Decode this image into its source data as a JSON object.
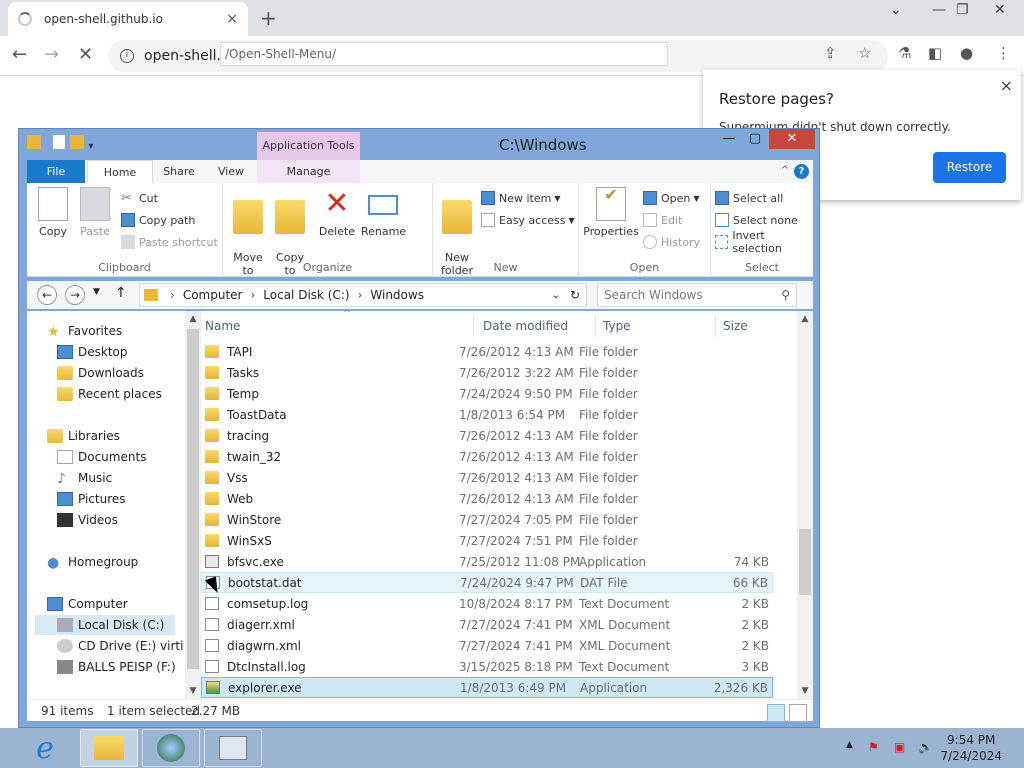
{
  "browser": {
    "tab_title": "open-shell.github.io",
    "tab_close": "×",
    "new_tab": "+",
    "url_host": "open-shell.github.io",
    "url_path": "/Open-Shell-Menu/",
    "restore_popup": {
      "title": "Restore pages?",
      "message": "Supermium didn't shut down correctly.",
      "button": "Restore",
      "close": "×"
    }
  },
  "explorer": {
    "title": "C:\\Windows",
    "context_tab_group": "Application Tools",
    "tabs": [
      "File",
      "Home",
      "Share",
      "View",
      "Manage"
    ],
    "help": "?",
    "ribbon": {
      "clipboard": {
        "label": "Clipboard",
        "copy": "Copy",
        "paste": "Paste",
        "cut": "Cut",
        "copy_path": "Copy path",
        "paste_shortcut": "Paste shortcut"
      },
      "organize": {
        "label": "Organize",
        "move_to": "Move\nto",
        "copy_to": "Copy\nto",
        "delete": "Delete",
        "rename": "Rename"
      },
      "new": {
        "label": "New",
        "new_folder": "New\nfolder",
        "new_item": "New item",
        "easy_access": "Easy access"
      },
      "open": {
        "label": "Open",
        "properties": "Properties",
        "open": "Open",
        "edit": "Edit",
        "history": "History"
      },
      "select": {
        "label": "Select",
        "select_all": "Select all",
        "select_none": "Select none",
        "invert_selection": "Invert selection"
      }
    },
    "address": {
      "crumbs": [
        "Computer",
        "Local Disk (C:)",
        "Windows"
      ],
      "search_placeholder": "Search Windows"
    },
    "nav": {
      "favorites": "Favorites",
      "desktop": "Desktop",
      "downloads": "Downloads",
      "recent": "Recent places",
      "libraries": "Libraries",
      "documents": "Documents",
      "music": "Music",
      "pictures": "Pictures",
      "videos": "Videos",
      "homegroup": "Homegroup",
      "computer": "Computer",
      "local_disk": "Local Disk (C:)",
      "cd_drive": "CD Drive (E:) virti",
      "balls": "BALLS PEISP (F:)"
    },
    "columns": [
      "Name",
      "Date modified",
      "Type",
      "Size"
    ],
    "files": [
      {
        "name": "TAPI",
        "date": "7/26/2012 4:13 AM",
        "type": "File folder",
        "size": "",
        "icon": "folder"
      },
      {
        "name": "Tasks",
        "date": "7/26/2012 3:22 AM",
        "type": "File folder",
        "size": "",
        "icon": "folder"
      },
      {
        "name": "Temp",
        "date": "7/24/2024 9:50 PM",
        "type": "File folder",
        "size": "",
        "icon": "folder"
      },
      {
        "name": "ToastData",
        "date": "1/8/2013 6:54 PM",
        "type": "File folder",
        "size": "",
        "icon": "folder"
      },
      {
        "name": "tracing",
        "date": "7/26/2012 4:13 AM",
        "type": "File folder",
        "size": "",
        "icon": "folder"
      },
      {
        "name": "twain_32",
        "date": "7/26/2012 4:13 AM",
        "type": "File folder",
        "size": "",
        "icon": "folder"
      },
      {
        "name": "Vss",
        "date": "7/26/2012 4:13 AM",
        "type": "File folder",
        "size": "",
        "icon": "folder"
      },
      {
        "name": "Web",
        "date": "7/26/2012 4:13 AM",
        "type": "File folder",
        "size": "",
        "icon": "folder"
      },
      {
        "name": "WinStore",
        "date": "7/27/2024 7:05 PM",
        "type": "File folder",
        "size": "",
        "icon": "folder"
      },
      {
        "name": "WinSxS",
        "date": "7/27/2024 7:51 PM",
        "type": "File folder",
        "size": "",
        "icon": "folder"
      },
      {
        "name": "bfsvc.exe",
        "date": "7/25/2012 11:08 PM",
        "type": "Application",
        "size": "74 KB",
        "icon": "app"
      },
      {
        "name": "bootstat.dat",
        "date": "7/24/2024 9:47 PM",
        "type": "DAT File",
        "size": "66 KB",
        "icon": "doc"
      },
      {
        "name": "comsetup.log",
        "date": "10/8/2024 8:17 PM",
        "type": "Text Document",
        "size": "2 KB",
        "icon": "doc"
      },
      {
        "name": "diagerr.xml",
        "date": "7/27/2024 7:41 PM",
        "type": "XML Document",
        "size": "2 KB",
        "icon": "doc"
      },
      {
        "name": "diagwrn.xml",
        "date": "7/27/2024 7:41 PM",
        "type": "XML Document",
        "size": "2 KB",
        "icon": "doc"
      },
      {
        "name": "DtcInstall.log",
        "date": "3/15/2025 8:18 PM",
        "type": "Text Document",
        "size": "3 KB",
        "icon": "doc"
      },
      {
        "name": "explorer.exe",
        "date": "1/8/2013 6:49 PM",
        "type": "Application",
        "size": "2,326 KB",
        "icon": "exe"
      }
    ],
    "status": {
      "items": "91 items",
      "selected": "1 item selected",
      "size": "2.27 MB"
    }
  },
  "taskbar": {
    "time": "9:54 PM",
    "date": "7/24/2024"
  }
}
